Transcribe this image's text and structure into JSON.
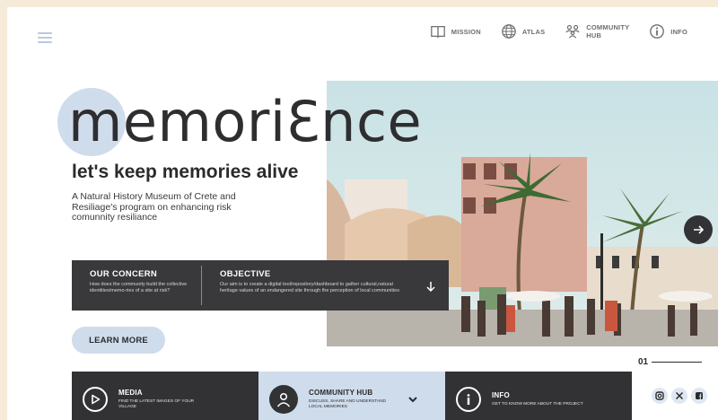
{
  "nav": {
    "items": [
      {
        "label": "MISSION",
        "icon": "book-icon"
      },
      {
        "label": "ATLAS",
        "icon": "globe-icon"
      },
      {
        "label": "COMMUNITY HUB",
        "icon": "people-icon"
      },
      {
        "label": "INFO",
        "icon": "info-icon"
      }
    ]
  },
  "hero": {
    "logo": "memoriƐnce",
    "tagline": "let's keep memories alive",
    "intro": "A Natural History Museum of Crete and Resiliage's program on enhancing risk comunnity resiliance"
  },
  "concern": {
    "title": "OUR CONCERN",
    "text": "How does the community build the collective identities/memo-ries of a site at risk?"
  },
  "objective": {
    "title": "OBJECTIVE",
    "text": "Our aim is to create a digital tool/repository/dashboard to gather cultural,natural heritage values of an endangered site through the perception of local communities"
  },
  "learn_more": "LEARN MORE",
  "slide": {
    "number": "01"
  },
  "bottom": {
    "media": {
      "title": "MEDIA",
      "text": "FIND THE LATEST IMAGES OF YOUR VILLAGE"
    },
    "community": {
      "title": "COMMUNITY HUB",
      "text": "DISCUSS, SHARE AND UNDERSTAND LOCAL MEMORIES"
    },
    "info": {
      "title": "INFO",
      "text": "GET TO KNOW MORE ABOUT THE PROJECT"
    }
  },
  "socials": [
    "instagram-icon",
    "x-icon",
    "facebook-icon"
  ],
  "colors": {
    "accent": "#cfdcec",
    "dark": "#323234",
    "background": "#f6ead8"
  }
}
